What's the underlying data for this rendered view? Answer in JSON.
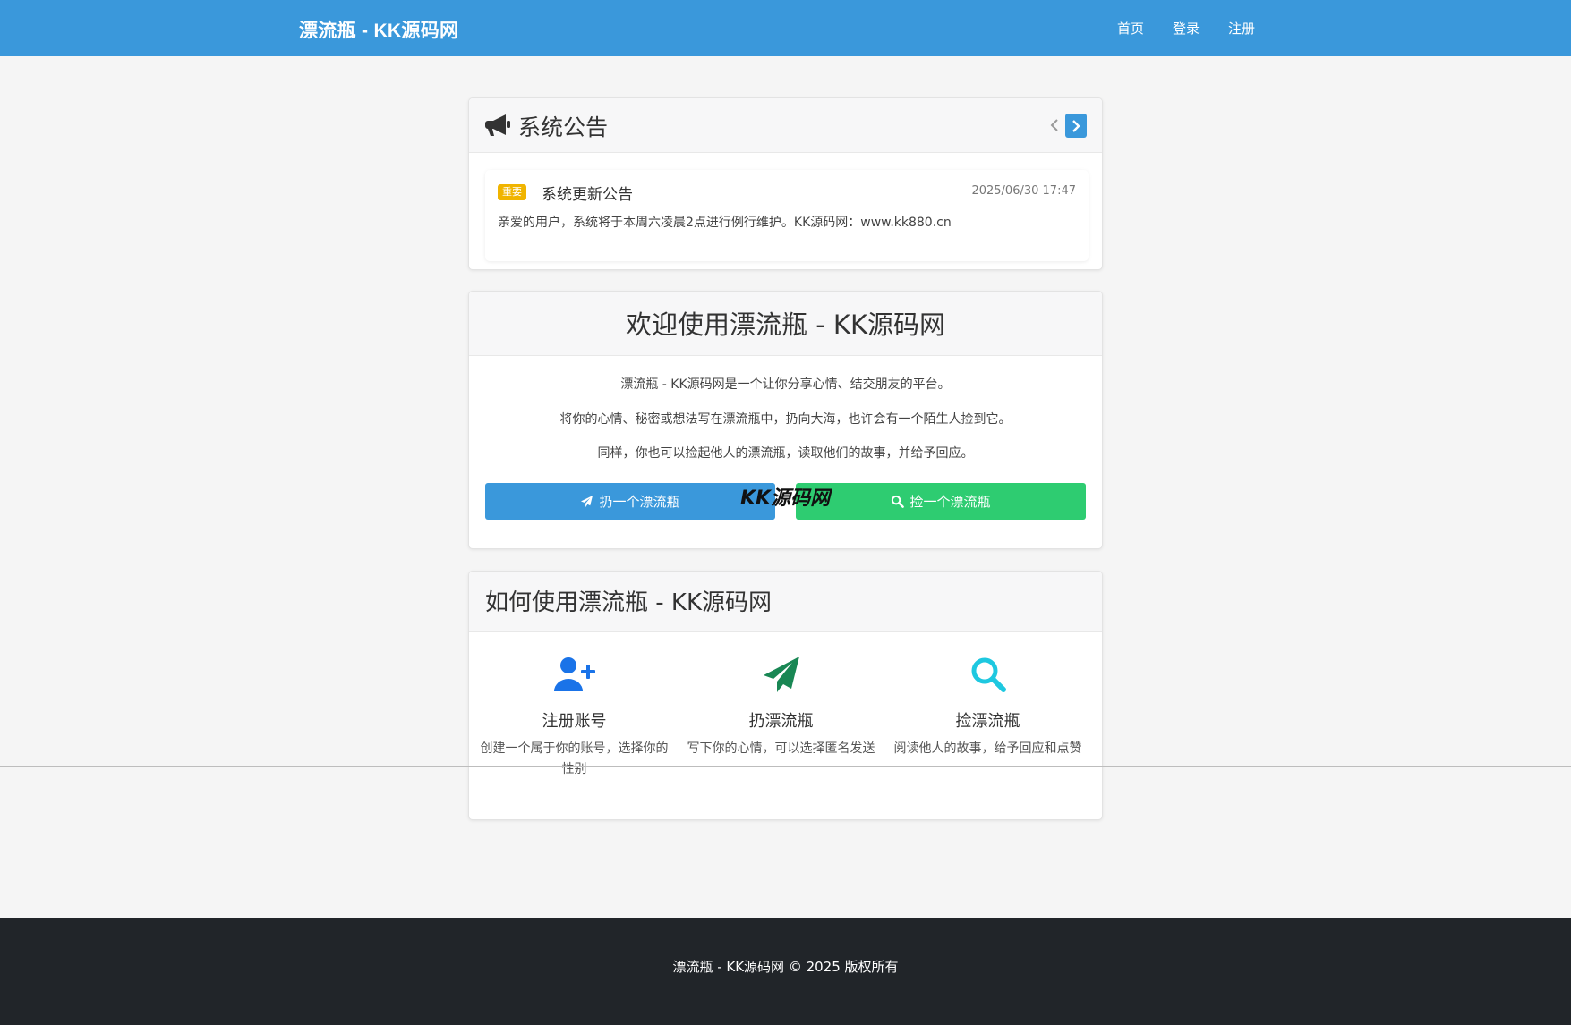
{
  "navbar": {
    "brand": "漂流瓶 - KK源码网",
    "links": [
      "首页",
      "登录",
      "注册"
    ]
  },
  "announcement": {
    "title": "系统公告",
    "icon": "megaphone-icon",
    "prev_icon": "chevron-left-icon",
    "next_icon": "chevron-right-icon",
    "item": {
      "badge": "重要",
      "title": "系统更新公告",
      "date": "2025/06/30 17:47",
      "body": "亲爱的用户，系统将于本周六凌晨2点进行例行维护。KK源码网：www.kk880.cn"
    }
  },
  "welcome": {
    "title": "欢迎使用漂流瓶 - KK源码网",
    "lines": [
      "漂流瓶 - KK源码网是一个让你分享心情、结交朋友的平台。",
      "将你的心情、秘密或想法写在漂流瓶中，扔向大海，也许会有一个陌生人捡到它。",
      "同样，你也可以捡起他人的漂流瓶，读取他们的故事，并给予回应。"
    ],
    "throw_button": "扔一个漂流瓶",
    "pick_button": "捡一个漂流瓶",
    "watermark": "KK源码网"
  },
  "howto": {
    "title": "如何使用漂流瓶 - KK源码网",
    "steps": [
      {
        "icon": "user-plus-icon",
        "title": "注册账号",
        "desc": "创建一个属于你的账号，选择你的性别"
      },
      {
        "icon": "paper-plane-icon",
        "title": "扔漂流瓶",
        "desc": "写下你的心情，可以选择匿名发送"
      },
      {
        "icon": "search-icon",
        "title": "捡漂流瓶",
        "desc": "阅读他人的故事，给予回应和点赞"
      }
    ]
  },
  "footer": {
    "text": "漂流瓶 - KK源码网 © 2025 版权所有"
  },
  "colors": {
    "primary": "#3a98db",
    "success": "#2ecc71",
    "warning": "#f0b400",
    "footer": "#212529",
    "step_icon_1": "#1a73e8",
    "step_icon_2": "#198754",
    "step_icon_3": "#1ec8e0"
  }
}
